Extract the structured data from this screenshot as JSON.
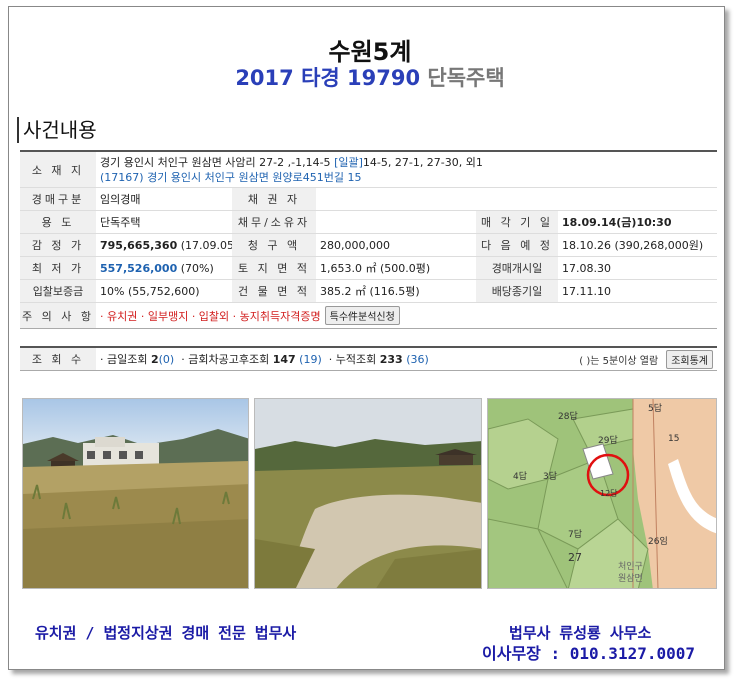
{
  "header": {
    "court": "수원5계",
    "case_no": "2017 타경 19790",
    "property_type": "단독주택"
  },
  "section_title": "사건내용",
  "address": {
    "label": "소 재 지",
    "line1": "경기 용인시 처인구 원삼면 사암리 27-2 ,-1,14-5",
    "bulk_tag": "[일괄]",
    "bulk_list": "14-5, 27-1, 27-30, 외1",
    "line2": "(17167) 경기 용인시 처인구 원삼면 원양로451번길 15"
  },
  "rows": {
    "auction_type_label": "경매구분",
    "auction_type": "임의경매",
    "creditor_label": "채 권 자",
    "creditor": "",
    "usage_label": "용 도",
    "usage": "단독주택",
    "debtor_label": "채무/소유자",
    "debtor": "",
    "sale_date_label": "매 각 기 일",
    "sale_date": "18.09.14(금)10:30",
    "appraisal_label": "감 정 가",
    "appraisal": "795,665,360",
    "appraisal_date": "(17.09.05)",
    "claim_label": "청 구 액",
    "claim": "280,000,000",
    "next_label": "다 음 예 정",
    "next": "18.10.26 (390,268,000원)",
    "min_label": "최 저 가",
    "min_price": "557,526,000",
    "min_pct": "(70%)",
    "land_label": "토 지 면 적",
    "land": "1,653.0 ㎡ (500.0평)",
    "start_label": "경매개시일",
    "start": "17.08.30",
    "deposit_label": "입찰보증금",
    "deposit": "10% (55,752,600)",
    "building_label": "건 물 면 적",
    "building": "385.2 ㎡ (116.5평)",
    "deadline_label": "배당종기일",
    "deadline": "17.11.10",
    "notes_label": "주 의 사 항",
    "notes": "· 유치권 · 일부맹지 · 입찰외 · 농지취득자격증명",
    "notes_button": "특수件분석신청"
  },
  "views": {
    "label": "조 회 수",
    "today_label": "· 금일조회",
    "today": "2",
    "today_paren": "(0)",
    "recent_label": "· 금회차공고후조회",
    "recent": "147",
    "recent_paren": "(19)",
    "total_label": "· 누적조회",
    "total": "233",
    "total_paren": "(36)",
    "note": "( )는 5분이상 열람",
    "stats_button": "조회통계"
  },
  "map_labels": {
    "p28": "28답",
    "p29": "29답",
    "p4": "4답",
    "p3": "3답",
    "p7": "7답",
    "p27": "27",
    "p26": "26임",
    "p15": "15",
    "p5": "5답",
    "p12": "12답",
    "town1": "처인구",
    "town2": "원삼면"
  },
  "footer": {
    "specialty": "유치권 / 법정지상권 경매 전문 법무사",
    "office": "법무사 류성룡 사무소",
    "phone": "이사무장 : 010.3127.0007"
  },
  "colors": {
    "accent_blue": "#2a3fb8",
    "link_blue": "#1e62b0",
    "warning_red": "#d21e1e",
    "footer_navy": "#1b1ba6"
  }
}
